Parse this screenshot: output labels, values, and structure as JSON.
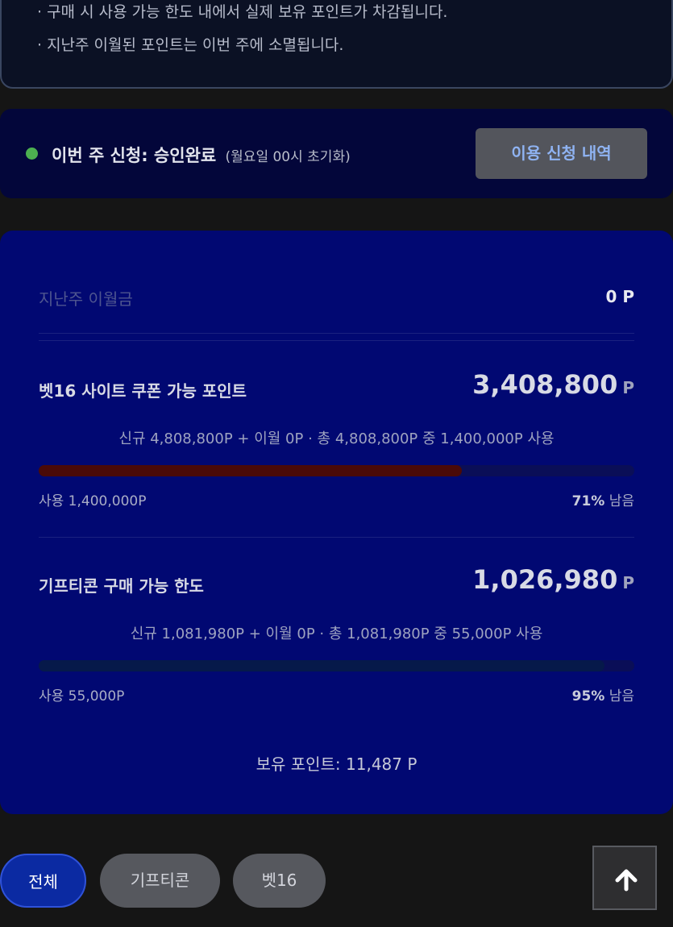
{
  "notice": {
    "lines": [
      "· 구매 시 사용 가능 한도 내에서 실제 보유 포인트가 차감됩니다.",
      "· 지난주 이월된 포인트는 이번 주에 소멸됩니다."
    ]
  },
  "status": {
    "text": "이번 주 신청: 승인완료",
    "note": "(월요일 00시 초기화)",
    "history_button": "이용 신청 내역",
    "dot_color": "#4caf50"
  },
  "points": {
    "carryover_label": "지난주 이월금",
    "carryover_value": "0 P",
    "b16": {
      "title": "벳16 사이트 쿠폰 가능 포인트",
      "amount": "3,408,800",
      "unit": "P",
      "detail": "신규 4,808,800P + 이월 0P · 총 4,808,800P 중 1,400,000P 사용",
      "used": "사용 1,400,000P",
      "remaining_pct": "71%",
      "remaining_suffix": "남음",
      "bar_fill_fraction": 0.71,
      "bar_color": "#4a0a08"
    },
    "gift": {
      "title": "기프티콘 구매 가능 한도",
      "amount": "1,026,980",
      "unit": "P",
      "detail": "신규 1,081,980P + 이월 0P · 총 1,081,980P 중 55,000P 사용",
      "used": "사용 55,000P",
      "remaining_pct": "95%",
      "remaining_suffix": "남음",
      "bar_fill_fraction": 0.95,
      "bar_color": "#06194a"
    },
    "holding": "보유 포인트: 11,487 P"
  },
  "filters": [
    "전체",
    "기프티콘",
    "벳16"
  ],
  "top_button_icon": "arrow-up-icon"
}
